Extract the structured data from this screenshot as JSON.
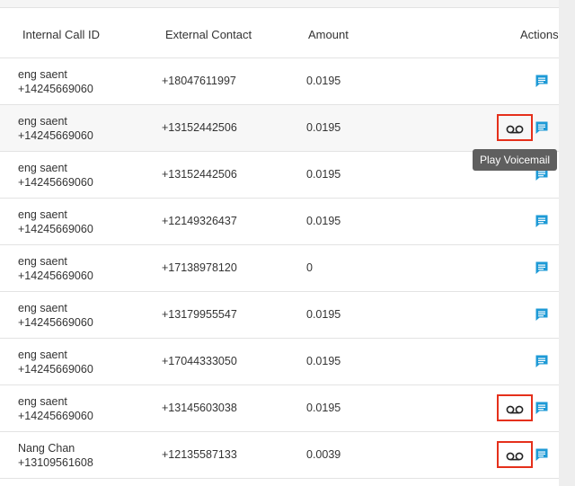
{
  "table": {
    "columns": [
      "Internal Call ID",
      "External Contact",
      "Amount",
      "Actions"
    ],
    "rows": [
      {
        "name": "eng saent",
        "number": "+14245669060",
        "external": "+18047611997",
        "amount": "0.0195",
        "voicemail": false
      },
      {
        "name": "eng saent",
        "number": "+14245669060",
        "external": "+13152442506",
        "amount": "0.0195",
        "voicemail": true
      },
      {
        "name": "eng saent",
        "number": "+14245669060",
        "external": "+13152442506",
        "amount": "0.0195",
        "voicemail": false
      },
      {
        "name": "eng saent",
        "number": "+14245669060",
        "external": "+12149326437",
        "amount": "0.0195",
        "voicemail": false
      },
      {
        "name": "eng saent",
        "number": "+14245669060",
        "external": "+17138978120",
        "amount": "0",
        "voicemail": false
      },
      {
        "name": "eng saent",
        "number": "+14245669060",
        "external": "+13179955547",
        "amount": "0.0195",
        "voicemail": false
      },
      {
        "name": "eng saent",
        "number": "+14245669060",
        "external": "+17044333050",
        "amount": "0.0195",
        "voicemail": false
      },
      {
        "name": "eng saent",
        "number": "+14245669060",
        "external": "+13145603038",
        "amount": "0.0195",
        "voicemail": true
      },
      {
        "name": "Nang Chan",
        "number": "+13109561608",
        "external": "+12135587133",
        "amount": "0.0039",
        "voicemail": true
      }
    ]
  },
  "tooltip": {
    "text": "Play Voicemail"
  },
  "icons": {
    "message": "message-icon",
    "voicemail": "voicemail-icon"
  },
  "colors": {
    "message_icon": "#1e9ad6",
    "highlight": "#e5301b",
    "tooltip_bg": "#5f5f5f"
  }
}
